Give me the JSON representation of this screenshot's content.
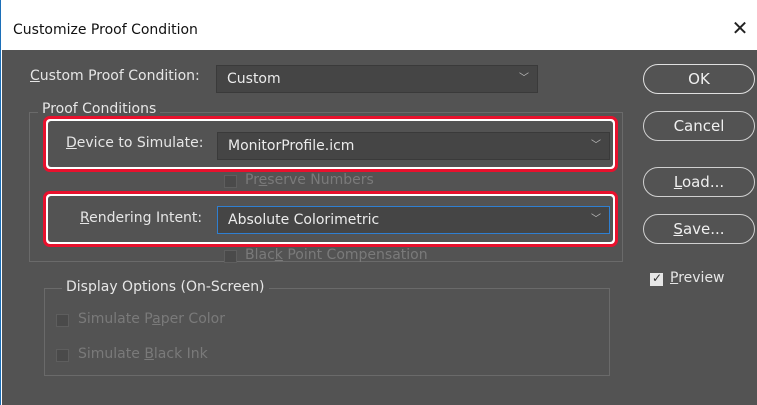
{
  "window": {
    "title": "Customize Proof Condition"
  },
  "custom_condition": {
    "label_prefix": "",
    "label_key": "C",
    "label_rest": "ustom Proof Condition:",
    "value": "Custom"
  },
  "proof_conditions": {
    "legend": "Proof Conditions",
    "device": {
      "label_key": "D",
      "label_rest": "evice to Simulate:",
      "value": "MonitorProfile.icm"
    },
    "preserve": {
      "label_pre": "Pr",
      "label_key": "e",
      "label_rest": "serve Numbers",
      "checked": false
    },
    "intent": {
      "label_key": "R",
      "label_rest": "endering Intent:",
      "value": "Absolute Colorimetric"
    },
    "bpc": {
      "label_pre": "Blac",
      "label_key": "k",
      "label_rest": " Point Compensation",
      "checked": false
    }
  },
  "display_options": {
    "legend": "Display Options (On-Screen)",
    "paper": {
      "label_pre": "Simulate P",
      "label_key": "a",
      "label_rest": "per Color",
      "checked": false
    },
    "ink": {
      "label_pre": "Simulate ",
      "label_key": "B",
      "label_rest": "lack Ink",
      "checked": false
    }
  },
  "buttons": {
    "ok": "OK",
    "cancel": "Cancel",
    "load_key": "L",
    "load_rest": "oad...",
    "save_key": "S",
    "save_rest": "ave..."
  },
  "preview": {
    "label_key": "P",
    "label_rest": "review",
    "checked": true
  },
  "colors": {
    "highlight": "#e8112d",
    "panel": "#535353",
    "field": "#454545"
  }
}
